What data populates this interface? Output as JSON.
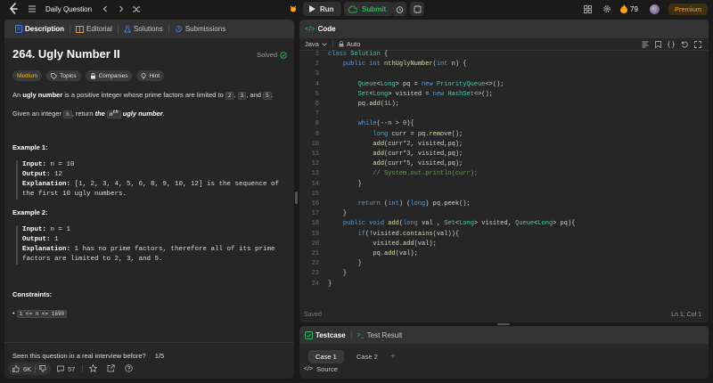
{
  "topbar": {
    "daily_label": "Daily Question",
    "run_label": "Run",
    "submit_label": "Submit",
    "streak_count": "79",
    "premium_label": "Premium"
  },
  "left_tabs": [
    {
      "label": "Description",
      "icon": "document-icon"
    },
    {
      "label": "Editorial",
      "icon": "book-icon"
    },
    {
      "label": "Solutions",
      "icon": "flask-icon"
    },
    {
      "label": "Submissions",
      "icon": "history-icon"
    }
  ],
  "problem": {
    "title": "264. Ugly Number II",
    "status": "Solved",
    "difficulty": "Medium",
    "chips": [
      "Topics",
      "Companies",
      "Hint"
    ],
    "p1_a": "An ",
    "p1_b": "ugly number",
    "p1_c": " is a positive integer whose prime factors are limited to ",
    "p1_n2": "2",
    "p1_comma": ",",
    "p1_n3": "3",
    "p1_and": ", and ",
    "p1_n5": "5",
    "p1_dot": ".",
    "p2_a": "Given an integer ",
    "p2_n": "n",
    "p2_b": ", return ",
    "p2_the": "the ",
    "p2_nth": "n",
    "p2_sup": "th",
    "p2_ugly": " ugly number",
    "p2_dot": ".",
    "ex1_head": "Example 1:",
    "ex1_input_label": "Input:",
    "ex1_input": " n = 10",
    "ex1_output_label": "Output:",
    "ex1_output": " 12",
    "ex1_expl_label": "Explanation:",
    "ex1_expl": " [1, 2, 3, 4, 5, 6, 8, 9, 10, 12] is the sequence of",
    "ex1_expl2": "the first 10 ugly numbers.",
    "ex2_head": "Example 2:",
    "ex2_input_label": "Input:",
    "ex2_input": " n = 1",
    "ex2_output_label": "Output:",
    "ex2_output": " 1",
    "ex2_expl_label": "Explanation:",
    "ex2_expl": " 1 has no prime factors, therefore all of its prime",
    "ex2_expl2": "factors are limited to 2, 3, and 5.",
    "constraints_head": "Constraints:",
    "constraint": "1 <= n <= 1690",
    "interview_q": "Seen this question in a real interview before?",
    "interview_pages": "1/5",
    "likes": "6K",
    "comments": "57"
  },
  "code_panel": {
    "title": "Code",
    "language": "Java",
    "mode": "Auto",
    "saved": "Saved",
    "cursor": "Ln 1, Col 1"
  },
  "code_lines": [
    "class Solution {",
    "    public int nthUglyNumber(int n) {",
    "",
    "        Queue<Long> pq = new PriorityQueue<>();",
    "        Set<Long> visited = new HashSet<>();",
    "        pq.add(1L);",
    "",
    "        while(--n > 0){",
    "            long curr = pq.remove();",
    "            add(curr*2, visited,pq);",
    "            add(curr*3, visited,pq);",
    "            add(curr*5, visited,pq);",
    "            // System.out.println(curr);",
    "        }",
    "",
    "        return (int) (long) pq.peek();",
    "    }",
    "    public void add(long val , Set<Long> visited, Queue<Long> pq){",
    "        if(!visited.contains(val)){",
    "            visited.add(val);",
    "            pq.add(val);",
    "        }",
    "    }",
    "}"
  ],
  "testcase": {
    "tab1": "Testcase",
    "tab2": "Test Result",
    "case1": "Case 1",
    "case2": "Case 2",
    "add": "+",
    "source": "Source"
  }
}
